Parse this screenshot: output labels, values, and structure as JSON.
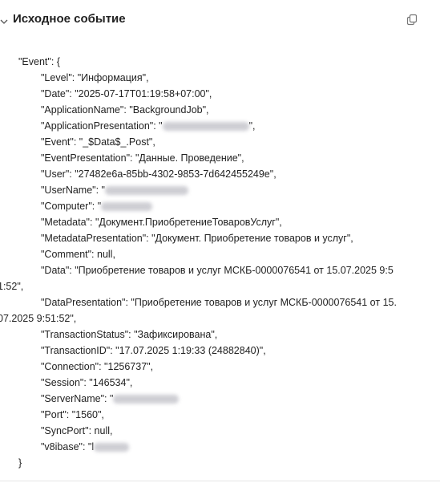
{
  "header": {
    "title": "Исходное событие",
    "collapse_icon": "chevron-down-icon",
    "copy_icon": "copy-icon"
  },
  "code": {
    "open_brace": "{",
    "event_open": "\"Event\": {",
    "level": "\"Level\": \"Информация\",",
    "date": "\"Date\": \"2025-07-17T01:19:58+07:00\",",
    "application_name": "\"ApplicationName\": \"BackgroundJob\",",
    "application_presentation_prefix": "\"ApplicationPresentation\": \"",
    "application_presentation_suffix": "\",",
    "event": "\"Event\": \"_$Data$_.Post\",",
    "event_presentation": "\"EventPresentation\": \"Данные. Проведение\",",
    "user": "\"User\": \"27482e6a-85bb-4302-9853-7d642455249e\",",
    "user_name_prefix": "\"UserName\": \"",
    "computer_prefix": "\"Computer\": \"",
    "metadata": "\"Metadata\": \"Документ.ПриобретениеТоваровУслуг\",",
    "metadata_presentation": "\"MetadataPresentation\": \"Документ. Приобретение товаров и услуг\",",
    "comment": "\"Comment\": null,",
    "data_line1": "\"Data\": \"Приобретение товаров и услуг МСКБ-0000076541 от 15.07.2025 9:5",
    "data_line2": "1:52\",",
    "data_presentation_line1": "\"DataPresentation\": \"Приобретение товаров и услуг МСКБ-0000076541 от 15.",
    "data_presentation_line2": "07.2025 9:51:52\",",
    "transaction_status": "\"TransactionStatus\": \"Зафиксирована\",",
    "transaction_id": "\"TransactionID\": \"17.07.2025 1:19:33 (24882840)\",",
    "connection": "\"Connection\": \"1256737\",",
    "session": "\"Session\": \"146534\",",
    "server_name_prefix": "\"ServerName\": \"",
    "port": "\"Port\": \"1560\",",
    "sync_port": "\"SyncPort\": null,",
    "v8ibase_prefix": "\"v8ibase\": \"l",
    "event_close": "}"
  }
}
